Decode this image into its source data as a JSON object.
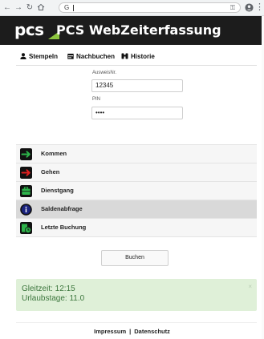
{
  "browser": {
    "omnibox_text": "G",
    "icons": [
      "back-icon",
      "forward-icon",
      "reload-icon",
      "home-icon",
      "key-icon",
      "account-icon",
      "menu-icon"
    ]
  },
  "header": {
    "logo_text": "pcs",
    "title": "PCS WebZeiterfassung",
    "background": "#1c1c1c",
    "logo_accent": "#8dc63f"
  },
  "tabs": [
    {
      "label": "Stempeln",
      "icon": "user-icon"
    },
    {
      "label": "Nachbuchen",
      "icon": "calendar-icon"
    },
    {
      "label": "Historie",
      "icon": "binoculars-icon"
    }
  ],
  "form": {
    "ausweis_label": "AusweisNr.",
    "ausweis_value": "12345",
    "pin_label": "PIN",
    "pin_value": "••••"
  },
  "actions": [
    {
      "label": "Kommen",
      "icon": "arrow-right-icon",
      "color": "#2db34a"
    },
    {
      "label": "Gehen",
      "icon": "arrow-left-icon",
      "color": "#e02020"
    },
    {
      "label": "Dienstgang",
      "icon": "briefcase-icon",
      "color": "#2db34a"
    },
    {
      "label": "Saldenabfrage",
      "icon": "info-icon",
      "color": "#1a237e",
      "selected": true
    },
    {
      "label": "Letzte Buchung",
      "icon": "clock-icon",
      "color": "#2db34a"
    }
  ],
  "submit_label": "Buchen",
  "info": {
    "line1": "Gleitzeit: 12:15",
    "line2": "Urlaubstage: 11.0",
    "close": "×",
    "background": "#dff0d8",
    "text_color": "#3c763d"
  },
  "footer": {
    "impressum": "Impressum",
    "separator": "|",
    "datenschutz": "Datenschutz"
  }
}
